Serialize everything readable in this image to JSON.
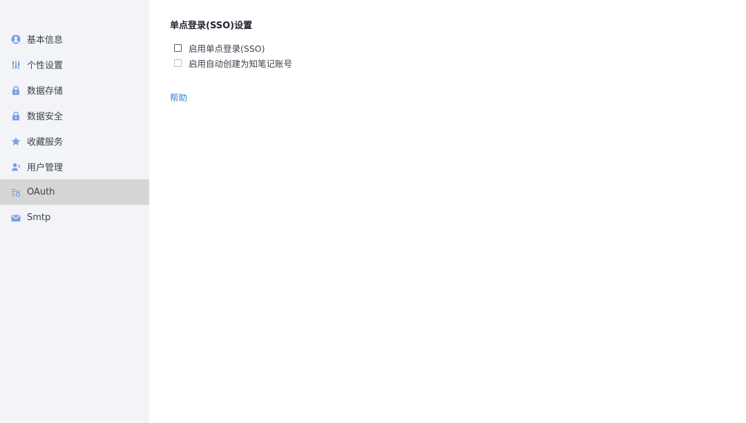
{
  "sidebar": {
    "items": [
      {
        "label": "基本信息",
        "icon": "user-circle-icon"
      },
      {
        "label": "个性设置",
        "icon": "sliders-icon"
      },
      {
        "label": "数据存储",
        "icon": "lock-icon"
      },
      {
        "label": "数据安全",
        "icon": "lock-icon"
      },
      {
        "label": "收藏服务",
        "icon": "star-icon"
      },
      {
        "label": "用户管理",
        "icon": "user-manage-icon"
      },
      {
        "label": "OAuth",
        "icon": "oauth-icon",
        "active": true
      },
      {
        "label": "Smtp",
        "icon": "mail-icon"
      }
    ],
    "icon_color": "#6b8fd6",
    "active_background": "#d6d6d6"
  },
  "main": {
    "title": "单点登录(SSO)设置",
    "options": [
      {
        "label": "启用单点登录(SSO)",
        "checked": false
      },
      {
        "label": "启用自动创建为知笔记账号",
        "checked": false
      }
    ],
    "help_label": "帮助",
    "link_color": "#3b82d6"
  }
}
